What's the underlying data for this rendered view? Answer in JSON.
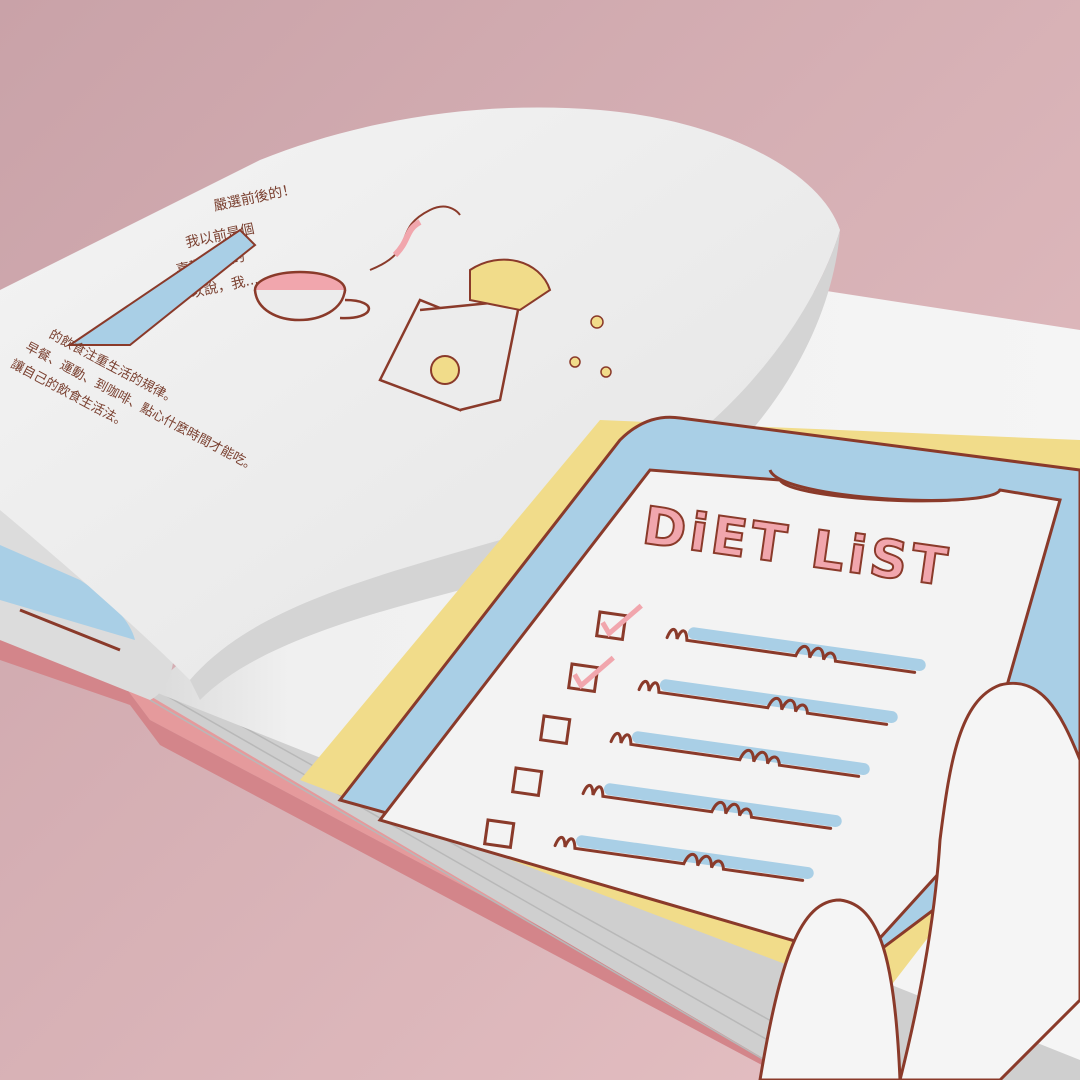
{
  "book": {
    "left_page": {
      "tag": "嚴選前後的！",
      "bubble_lines": [
        "我以前是個",
        "喜歡早餐的",
        "可以說，我..."
      ],
      "paragraph_lines": [
        "的飲食注重生活的規律。",
        "早餐、運動、到咖啡、點心什麼時間才能吃。",
        "讓自己的飲食生活法。"
      ]
    },
    "right_page": {
      "heading": "DiET LiST",
      "checklist": [
        {
          "checked": true
        },
        {
          "checked": true
        },
        {
          "checked": false
        },
        {
          "checked": false
        },
        {
          "checked": false
        }
      ]
    }
  },
  "colors": {
    "background": "#d9aeb3",
    "cover": "#e59a9c",
    "paper": "#f1f1f1",
    "ink": "#8a3a2a",
    "pink_accent": "#f1a6ad",
    "blue_accent": "#a9cfe6",
    "yellow_accent": "#f1dc8a"
  }
}
